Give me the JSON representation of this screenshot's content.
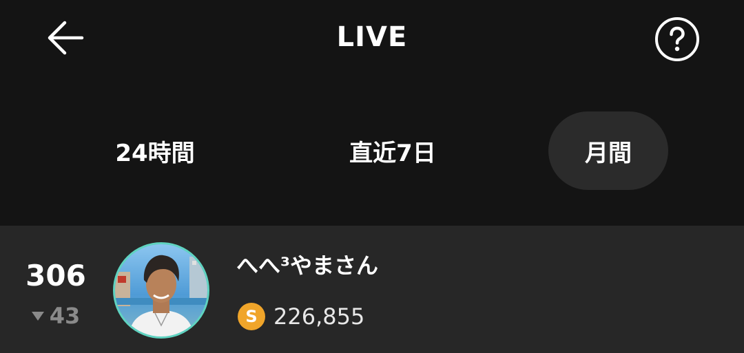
{
  "header": {
    "title": "LIVE",
    "back_icon": "arrow-left-icon",
    "help_icon": "question-circle-icon"
  },
  "tabs": [
    {
      "label": "24時間",
      "active": false
    },
    {
      "label": "直近7日",
      "active": false
    },
    {
      "label": "月間",
      "active": true
    }
  ],
  "ranking": [
    {
      "rank": "306",
      "change": "43",
      "change_direction": "down",
      "name": "へへ³やまさん",
      "coins": "226,855",
      "coin_symbol": "S",
      "avatar_icon": "user-avatar"
    }
  ],
  "colors": {
    "background": "#141414",
    "row": "#272727",
    "active_tab": "#2b2b2b",
    "avatar_ring": "#5fd3c0",
    "coin": "#f0a52a",
    "muted": "#8a8a8a"
  }
}
